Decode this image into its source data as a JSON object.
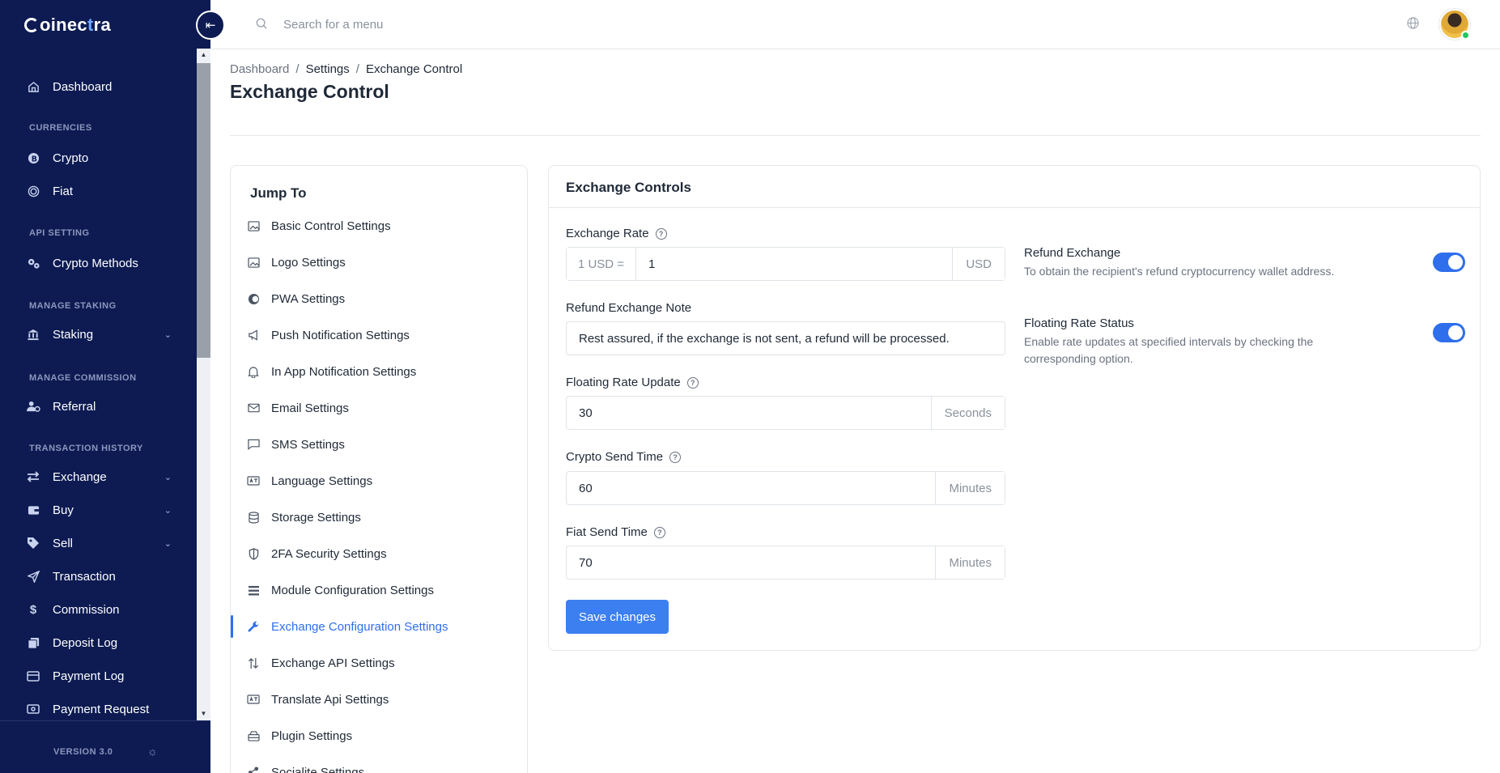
{
  "brand": {
    "name_part1": "oinec",
    "name_part2": "t",
    "name_part3": "ra"
  },
  "sidebar": {
    "items": [
      {
        "label": "Dashboard",
        "icon": "home-icon"
      },
      {
        "section": "CURRENCIES"
      },
      {
        "label": "Crypto",
        "icon": "bitcoin-icon"
      },
      {
        "label": "Fiat",
        "icon": "coin-icon"
      },
      {
        "section": "API SETTING"
      },
      {
        "label": "Crypto Methods",
        "icon": "gears-icon"
      },
      {
        "section": "MANAGE STAKING"
      },
      {
        "label": "Staking",
        "icon": "bank-icon"
      },
      {
        "section": "MANAGE COMMISSION"
      },
      {
        "label": "Referral",
        "icon": "user-gear-icon"
      },
      {
        "section": "TRANSACTION HISTORY"
      },
      {
        "label": "Exchange",
        "icon": "arrows-icon"
      },
      {
        "label": "Buy",
        "icon": "wallet-icon"
      },
      {
        "label": "Sell",
        "icon": "tag-icon"
      },
      {
        "label": "Transaction",
        "icon": "send-icon"
      },
      {
        "label": "Commission",
        "icon": "dollar-icon"
      },
      {
        "label": "Deposit Log",
        "icon": "copy-icon"
      },
      {
        "label": "Payment Log",
        "icon": "card-icon"
      },
      {
        "label": "Payment Request",
        "icon": "money-icon"
      }
    ],
    "version": "VERSION 3.0"
  },
  "topbar": {
    "search_placeholder": "Search for a menu"
  },
  "breadcrumb": {
    "home": "Dashboard",
    "mid": "Settings",
    "current": "Exchange Control",
    "sep": "/"
  },
  "page_title": "Exchange Control",
  "jump": {
    "title": "Jump To",
    "items": [
      {
        "label": "Basic Control Settings",
        "icon": "image-icon"
      },
      {
        "label": "Logo Settings",
        "icon": "image-icon"
      },
      {
        "label": "PWA Settings",
        "icon": "pwa-icon"
      },
      {
        "label": "Push Notification Settings",
        "icon": "megaphone-icon"
      },
      {
        "label": "In App Notification Settings",
        "icon": "bell-icon"
      },
      {
        "label": "Email Settings",
        "icon": "envelope-icon"
      },
      {
        "label": "SMS Settings",
        "icon": "chat-icon"
      },
      {
        "label": "Language Settings",
        "icon": "language-icon"
      },
      {
        "label": "Storage Settings",
        "icon": "database-icon"
      },
      {
        "label": "2FA Security Settings",
        "icon": "shield-icon"
      },
      {
        "label": "Module Configuration Settings",
        "icon": "list-icon"
      },
      {
        "label": "Exchange Configuration Settings",
        "icon": "wrench-icon",
        "active": true
      },
      {
        "label": "Exchange API Settings",
        "icon": "swap-icon"
      },
      {
        "label": "Translate Api Settings",
        "icon": "translate-icon"
      },
      {
        "label": "Plugin Settings",
        "icon": "plugin-icon"
      },
      {
        "label": "Socialite Settings",
        "icon": "share-icon"
      }
    ]
  },
  "exchange": {
    "title": "Exchange Controls",
    "rate": {
      "label": "Exchange Rate",
      "prefix": "1 USD =",
      "value": "1",
      "suffix": "USD"
    },
    "note": {
      "label": "Refund Exchange Note",
      "value": "Rest assured, if the exchange is not sent, a refund will be processed."
    },
    "floating": {
      "label": "Floating Rate Update",
      "value": "30",
      "suffix": "Seconds"
    },
    "crypto_send": {
      "label": "Crypto Send Time",
      "value": "60",
      "suffix": "Minutes"
    },
    "fiat_send": {
      "label": "Fiat Send Time",
      "value": "70",
      "suffix": "Minutes"
    },
    "save": "Save changes",
    "refund_toggle": {
      "title": "Refund Exchange",
      "desc": "To obtain the recipient's refund cryptocurrency wallet address.",
      "on": true
    },
    "floating_toggle": {
      "title": "Floating Rate Status",
      "desc": "Enable rate updates at specified intervals by checking the corresponding option.",
      "on": true
    }
  },
  "colors": {
    "sidebar_bg": "#0d1b52",
    "accent": "#2f6fec",
    "button": "#3b7ff0"
  }
}
